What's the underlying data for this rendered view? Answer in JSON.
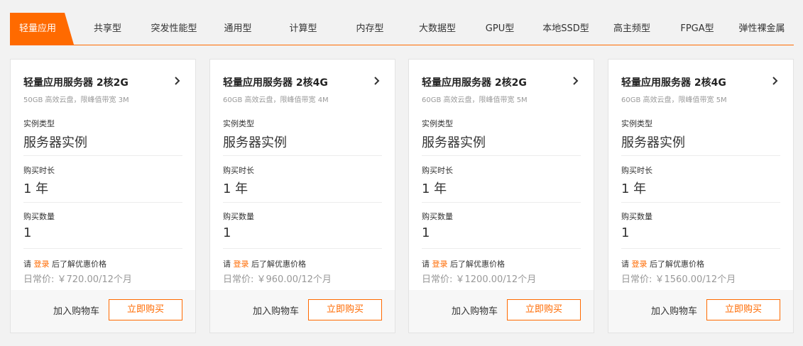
{
  "accent_color": "#ff6a00",
  "tabs": [
    {
      "label": "轻量应用",
      "active": true
    },
    {
      "label": "共享型"
    },
    {
      "label": "突发性能型"
    },
    {
      "label": "通用型"
    },
    {
      "label": "计算型"
    },
    {
      "label": "内存型"
    },
    {
      "label": "大数据型"
    },
    {
      "label": "GPU型"
    },
    {
      "label": "本地SSD型"
    },
    {
      "label": "高主频型"
    },
    {
      "label": "FPGA型"
    },
    {
      "label": "弹性裸金属"
    }
  ],
  "common": {
    "instance_type_label": "实例类型",
    "duration_label": "购买时长",
    "quantity_label": "购买数量",
    "login_prefix": "请",
    "login_link": "登录",
    "login_suffix": "后了解优惠价格",
    "cart_label": "加入购物车",
    "buy_label": "立即购买",
    "chevron_icon": "chevron-right-icon"
  },
  "cards": [
    {
      "title": "轻量应用服务器 2核2G",
      "subtitle": "50GB 高效云盘，限峰值带宽 3M",
      "instance_type": "服务器实例",
      "duration": "1 年",
      "quantity": "1",
      "price": "日常价: ￥720.00/12个月"
    },
    {
      "title": "轻量应用服务器 2核4G",
      "subtitle": "60GB 高效云盘，限峰值带宽 4M",
      "instance_type": "服务器实例",
      "duration": "1 年",
      "quantity": "1",
      "price": "日常价: ￥960.00/12个月"
    },
    {
      "title": "轻量应用服务器 2核2G",
      "subtitle": "60GB 高效云盘，限峰值带宽 5M",
      "instance_type": "服务器实例",
      "duration": "1 年",
      "quantity": "1",
      "price": "日常价: ￥1200.00/12个月"
    },
    {
      "title": "轻量应用服务器 2核4G",
      "subtitle": "60GB 高效云盘，限峰值带宽 5M",
      "instance_type": "服务器实例",
      "duration": "1 年",
      "quantity": "1",
      "price": "日常价: ￥1560.00/12个月"
    }
  ]
}
